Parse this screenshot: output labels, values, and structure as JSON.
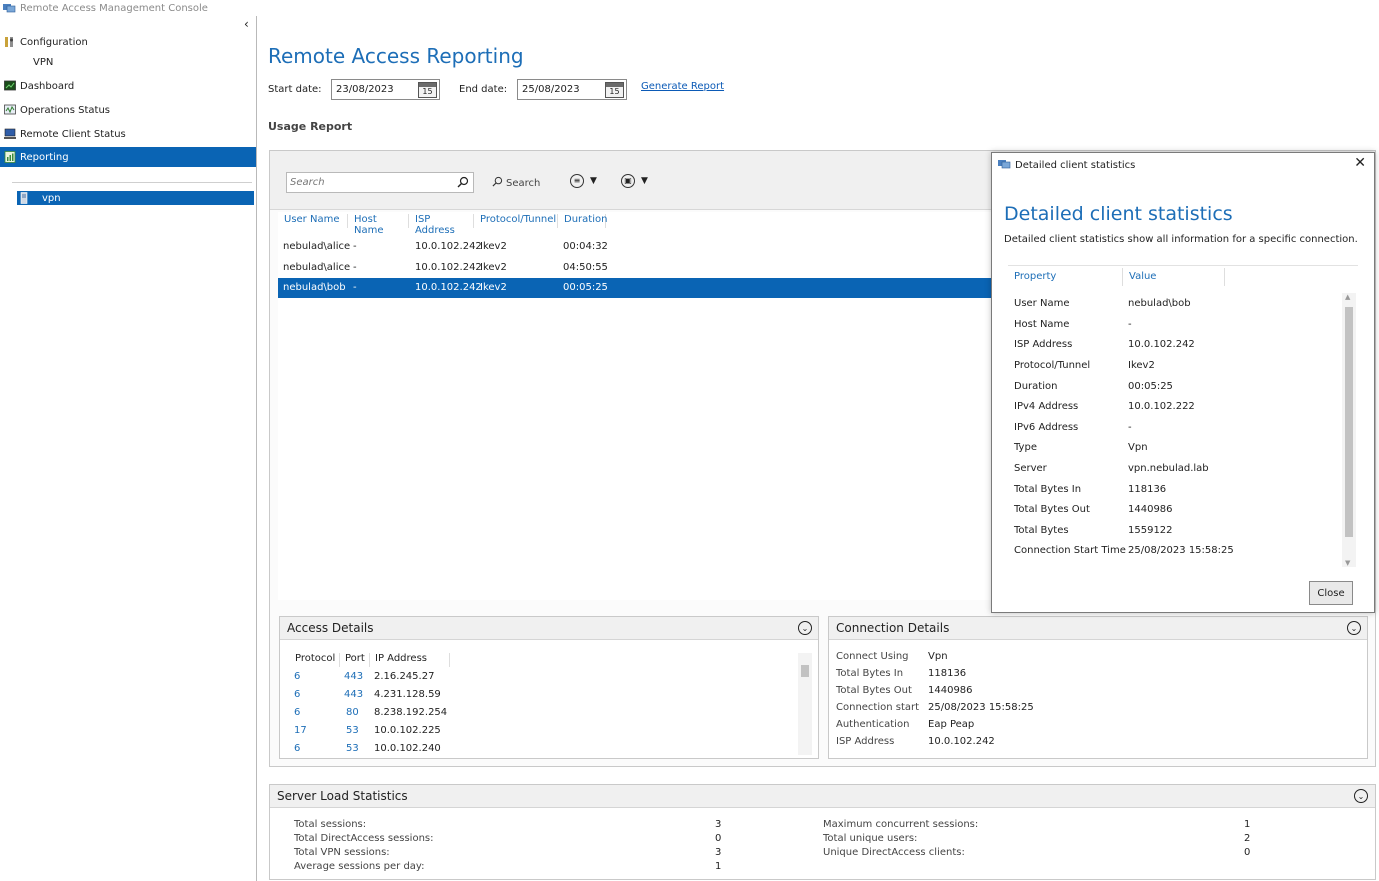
{
  "app": {
    "title": "Remote Access Management Console"
  },
  "nav": {
    "items": [
      {
        "label": "Configuration",
        "icon": "configuration-icon"
      },
      {
        "label": "VPN",
        "icon": ""
      },
      {
        "label": "Dashboard",
        "icon": "dashboard-icon"
      },
      {
        "label": "Operations Status",
        "icon": "operations-status-icon"
      },
      {
        "label": "Remote Client Status",
        "icon": "remote-client-icon"
      },
      {
        "label": "Reporting",
        "icon": "reporting-icon"
      }
    ],
    "server": "vpn"
  },
  "header": {
    "title": "Remote Access Reporting",
    "start_label": "Start date:",
    "start_value": "23/08/2023",
    "end_label": "End date:",
    "end_value": "25/08/2023",
    "calendar_day": "15",
    "generate_link": "Generate Report",
    "usage_title": "Usage Report"
  },
  "toolbar": {
    "search_placeholder": "Search",
    "search_button": "Search"
  },
  "grid": {
    "columns": [
      "User Name",
      "Host Name",
      "ISP Address",
      "Protocol/Tunnel",
      "Duration"
    ],
    "rows": [
      [
        "nebulad\\alice",
        "-",
        "10.0.102.242",
        "Ikev2",
        "00:04:32"
      ],
      [
        "nebulad\\alice",
        "-",
        "10.0.102.242",
        "Ikev2",
        "04:50:55"
      ],
      [
        "nebulad\\bob",
        "-",
        "10.0.102.242",
        "Ikev2",
        "00:05:25"
      ]
    ],
    "selected_row": 2
  },
  "access_details": {
    "title": "Access Details",
    "columns": [
      "Protocol",
      "Port",
      "IP Address"
    ],
    "rows": [
      [
        "6",
        "443",
        "2.16.245.27"
      ],
      [
        "6",
        "443",
        "4.231.128.59"
      ],
      [
        "6",
        "80",
        "8.238.192.254"
      ],
      [
        "17",
        "53",
        "10.0.102.225"
      ],
      [
        "6",
        "53",
        "10.0.102.240"
      ]
    ]
  },
  "connection_details": {
    "title": "Connection Details",
    "rows": [
      [
        "Connect Using",
        "Vpn"
      ],
      [
        "Total Bytes In",
        "118136"
      ],
      [
        "Total Bytes Out",
        "1440986"
      ],
      [
        "Connection start",
        "25/08/2023 15:58:25"
      ],
      [
        "Authentication",
        "Eap Peap"
      ],
      [
        "ISP Address",
        "10.0.102.242"
      ]
    ]
  },
  "server_load": {
    "title": "Server Load Statistics",
    "left": [
      [
        "Total sessions:",
        "3"
      ],
      [
        "Total DirectAccess sessions:",
        "0"
      ],
      [
        "Total VPN sessions:",
        "3"
      ],
      [
        "Average sessions per day:",
        "1"
      ]
    ],
    "right": [
      [
        "Maximum concurrent sessions:",
        "1"
      ],
      [
        "Total unique users:",
        "2"
      ],
      [
        "Unique DirectAccess clients:",
        "0"
      ]
    ]
  },
  "dialog": {
    "window_title": "Detailed client statistics",
    "heading": "Detailed client statistics",
    "description": "Detailed client statistics show all information for a specific connection.",
    "property_header": "Property",
    "value_header": "Value",
    "rows": [
      [
        "User Name",
        "nebulad\\bob"
      ],
      [
        "Host Name",
        "-"
      ],
      [
        "ISP Address",
        "10.0.102.242"
      ],
      [
        "Protocol/Tunnel",
        "Ikev2"
      ],
      [
        "Duration",
        "00:05:25"
      ],
      [
        "IPv4 Address",
        "10.0.102.222"
      ],
      [
        "IPv6 Address",
        "-"
      ],
      [
        "Type",
        "Vpn"
      ],
      [
        "Server",
        "vpn.nebulad.lab"
      ],
      [
        "Total Bytes In",
        "118136"
      ],
      [
        "Total Bytes Out",
        "1440986"
      ],
      [
        "Total Bytes",
        "1559122"
      ],
      [
        "Connection Start Time",
        "25/08/2023 15:58:25"
      ]
    ],
    "close_button": "Close"
  },
  "colors": {
    "accent": "#1d6eb7",
    "selection": "#0a64b4"
  }
}
